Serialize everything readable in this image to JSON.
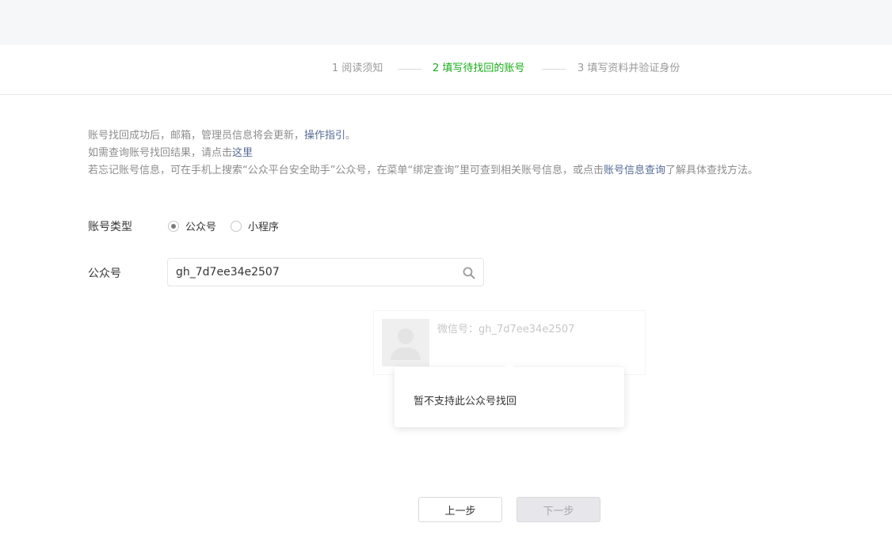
{
  "steps": [
    {
      "label": "1 阅读须知",
      "active": false
    },
    {
      "label": "2 填写待找回的账号",
      "active": true
    },
    {
      "label": "3 填写资料并验证身份",
      "active": false
    }
  ],
  "notice": {
    "line1_text": "账号找回成功后，邮箱，管理员信息将会更新，",
    "line1_link": "操作指引",
    "line1_end": "。",
    "line2_text": "如需查询账号找回结果，请点击",
    "line2_link": "这里",
    "line3_text": "若忘记账号信息，可在手机上搜索“公众平台安全助手”公众号，在菜单“绑定查询”里可查到相关账号信息，或点击",
    "line3_link": "账号信息查询",
    "line3_end": "了解具体查找方法。"
  },
  "form": {
    "type_label": "账号类型",
    "type_options": [
      {
        "label": "公众号",
        "checked": true
      },
      {
        "label": "小程序",
        "checked": false
      }
    ],
    "account_label": "公众号",
    "account_value": "gh_7d7ee34e2507"
  },
  "result": {
    "id_text": "微信号：gh_7d7ee34e2507",
    "avatar_icon": "user-avatar-icon"
  },
  "tooltip": {
    "message": "暂不支持此公众号找回"
  },
  "buttons": {
    "prev": "上一步",
    "next": "下一步"
  },
  "colors": {
    "accent": "#1aad19",
    "link": "#576b95",
    "muted": "#8d8d8d"
  }
}
